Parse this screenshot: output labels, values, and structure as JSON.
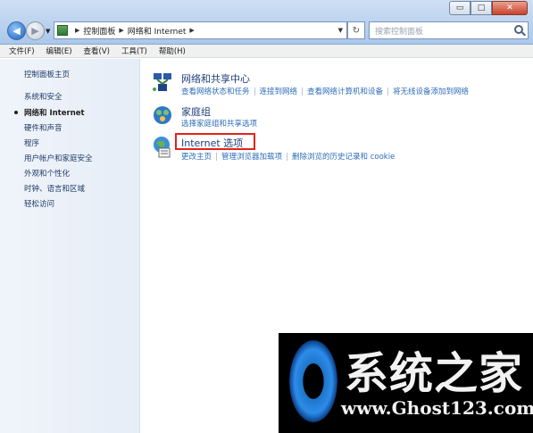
{
  "window": {
    "minimize_label": "▭",
    "maximize_label": "□",
    "close_label": "✕"
  },
  "nav": {
    "back_glyph": "◀",
    "forward_glyph": "▶"
  },
  "address": {
    "crumbs": [
      "控制面板",
      "网络和 Internet"
    ]
  },
  "search": {
    "placeholder": "搜索控制面板"
  },
  "menu": {
    "items": [
      "文件(F)",
      "编辑(E)",
      "查看(V)",
      "工具(T)",
      "帮助(H)"
    ]
  },
  "sidebar": {
    "items": [
      {
        "label": "控制面板主页"
      },
      {
        "label": "系统和安全"
      },
      {
        "label": "网络和 Internet",
        "active": true
      },
      {
        "label": "硬件和声音"
      },
      {
        "label": "程序"
      },
      {
        "label": "用户帐户和家庭安全"
      },
      {
        "label": "外观和个性化"
      },
      {
        "label": "时钟、语言和区域"
      },
      {
        "label": "轻松访问"
      }
    ]
  },
  "categories": [
    {
      "title": "网络和共享中心",
      "icon": "network-sharing-icon",
      "tasks": [
        "查看网络状态和任务",
        "连接到网络",
        "查看网络计算机和设备",
        "将无线设备添加到网络"
      ]
    },
    {
      "title": "家庭组",
      "icon": "homegroup-icon",
      "tasks": [
        "选择家庭组和共享选项"
      ]
    },
    {
      "title": "Internet 选项",
      "icon": "internet-options-icon",
      "tasks": [
        "更改主页",
        "管理浏览器加载项",
        "删除浏览的历史记录和 cookie"
      ]
    }
  ],
  "highlight_color": "#e2231a",
  "watermark": {
    "title": "系统之家",
    "url": "www.Ghost123.com"
  }
}
